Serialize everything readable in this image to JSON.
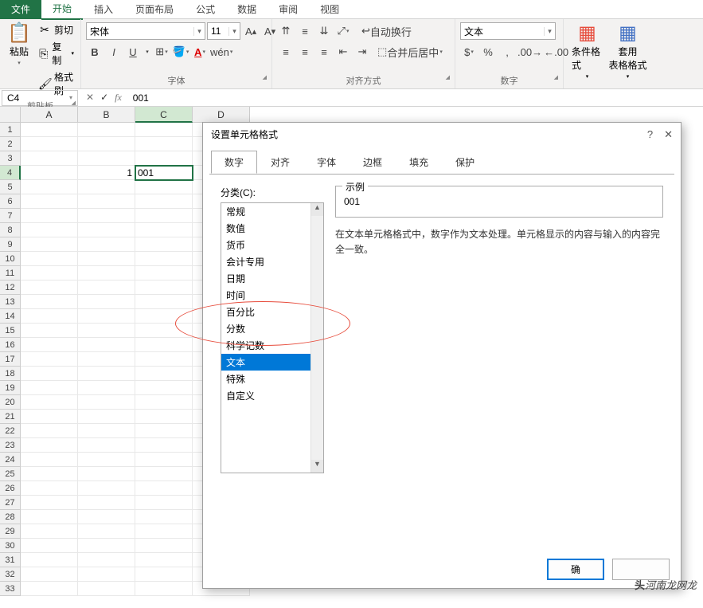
{
  "tabs": {
    "file": "文件",
    "home": "开始",
    "insert": "插入",
    "layout": "页面布局",
    "formula": "公式",
    "data": "数据",
    "review": "审阅",
    "view": "视图"
  },
  "ribbon": {
    "clipboard": {
      "label": "剪贴板",
      "paste": "粘贴",
      "cut": "剪切",
      "copy": "复制",
      "painter": "格式刷"
    },
    "font": {
      "label": "字体",
      "name": "宋体",
      "size": "11",
      "bold": "B",
      "italic": "I",
      "underline": "U"
    },
    "align": {
      "label": "对齐方式",
      "wrap": "自动换行",
      "merge": "合并后居中"
    },
    "number": {
      "label": "数字",
      "format": "文本"
    },
    "styles": {
      "cond": "条件格式",
      "table": "套用\n表格格式"
    }
  },
  "fbar": {
    "cell": "C4",
    "fx": "fx",
    "value": "001"
  },
  "grid": {
    "cols": [
      "A",
      "B",
      "C",
      "D"
    ],
    "b4": "1",
    "c4": "001",
    "rowcount": 33
  },
  "dialog": {
    "title": "设置单元格格式",
    "help": "?",
    "close": "✕",
    "tabs": {
      "number": "数字",
      "align": "对齐",
      "font": "字体",
      "border": "边框",
      "fill": "填充",
      "protect": "保护"
    },
    "catlabel": "分类(C):",
    "cats": [
      "常规",
      "数值",
      "货币",
      "会计专用",
      "日期",
      "时间",
      "百分比",
      "分数",
      "科学记数",
      "文本",
      "特殊",
      "自定义"
    ],
    "selected": "文本",
    "sample_label": "示例",
    "sample": "001",
    "desc": "在文本单元格格式中，数字作为文本处理。单元格显示的内容与输入的内容完全一致。",
    "ok": "确",
    "cancel": ""
  },
  "watermark": "头河南龙网龙"
}
